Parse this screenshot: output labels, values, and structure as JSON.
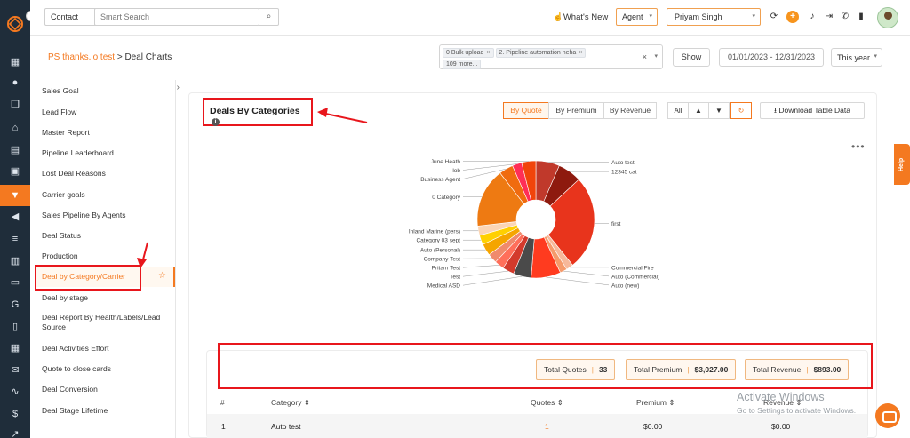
{
  "topbar": {
    "contact_label": "Contact",
    "search_placeholder": "Smart Search",
    "whats_new": "What's New",
    "agent_label": "Agent",
    "user_name": "Priyam Singh"
  },
  "header": {
    "org": "PS thanks.io test",
    "sep": " > ",
    "page": "Deal Charts",
    "filter_tags": [
      "0 Bulk upload",
      "2. Pipeline automation neha",
      "109 more..."
    ],
    "show_label": "Show",
    "date_range": "01/01/2023 - 12/31/2023",
    "period": "This year"
  },
  "reports": [
    "Sales Goal",
    "Lead Flow",
    "Master Report",
    "Pipeline Leaderboard",
    "Lost Deal Reasons",
    "Carrier goals",
    "Sales Pipeline By Agents",
    "Deal Status",
    "Production",
    "Deal by Category/Carrier",
    "Deal by stage",
    "Deal Report By Health/Labels/Lead Source",
    "Deal Activities Effort",
    "Quote to close cards",
    "Deal Conversion",
    "Deal Stage Lifetime"
  ],
  "card": {
    "title": "Deals By Categories",
    "by_quote": "By Quote",
    "by_premium": "By Premium",
    "by_revenue": "By Revenue",
    "all": "All",
    "download": "Download Table Data"
  },
  "chart_data": {
    "type": "pie",
    "categories": [
      "Auto test",
      "12345 cat",
      "first",
      "Commercial Fire",
      "Auto (Commercial)",
      "Auto (new)",
      "Medical ASD",
      "Test",
      "Pritam Test",
      "Company Test",
      "Auto (Personal)",
      "Category 03 sept",
      "Inland Marine (pers)",
      "0 Category",
      "Business Agent",
      "lob",
      "June Heath"
    ],
    "values": [
      2,
      2,
      8,
      0.6,
      0.6,
      2.5,
      1.5,
      1,
      0.8,
      0.8,
      1,
      0.8,
      0.8,
      5,
      1.2,
      0.8,
      1.2
    ],
    "colors": [
      "#c0392b",
      "#8e1a0e",
      "#e8341c",
      "#f7b89a",
      "#f59a6b",
      "#ff3b1f",
      "#4a4a4a",
      "#d33a2c",
      "#ff6f5a",
      "#f08a6c",
      "#f5a500",
      "#ffd000",
      "#fbd5b5",
      "#ee7a12",
      "#f06b0f",
      "#ff2e56",
      "#f1440b"
    ],
    "title": "",
    "legend": "none"
  },
  "totals": {
    "quotes_label": "Total Quotes",
    "quotes_value": "33",
    "premium_label": "Total Premium",
    "premium_value": "$3,027.00",
    "revenue_label": "Total Revenue",
    "revenue_value": "$893.00"
  },
  "table": {
    "headers": [
      "#",
      "Category",
      "Quotes",
      "Premium",
      "Revenue"
    ],
    "rows": [
      [
        "1",
        "Auto test",
        "1",
        "$0.00",
        "$0.00"
      ]
    ]
  },
  "watermark": {
    "line1": "Activate Windows",
    "line2": "Go to Settings to activate Windows."
  },
  "help_label": "Help"
}
